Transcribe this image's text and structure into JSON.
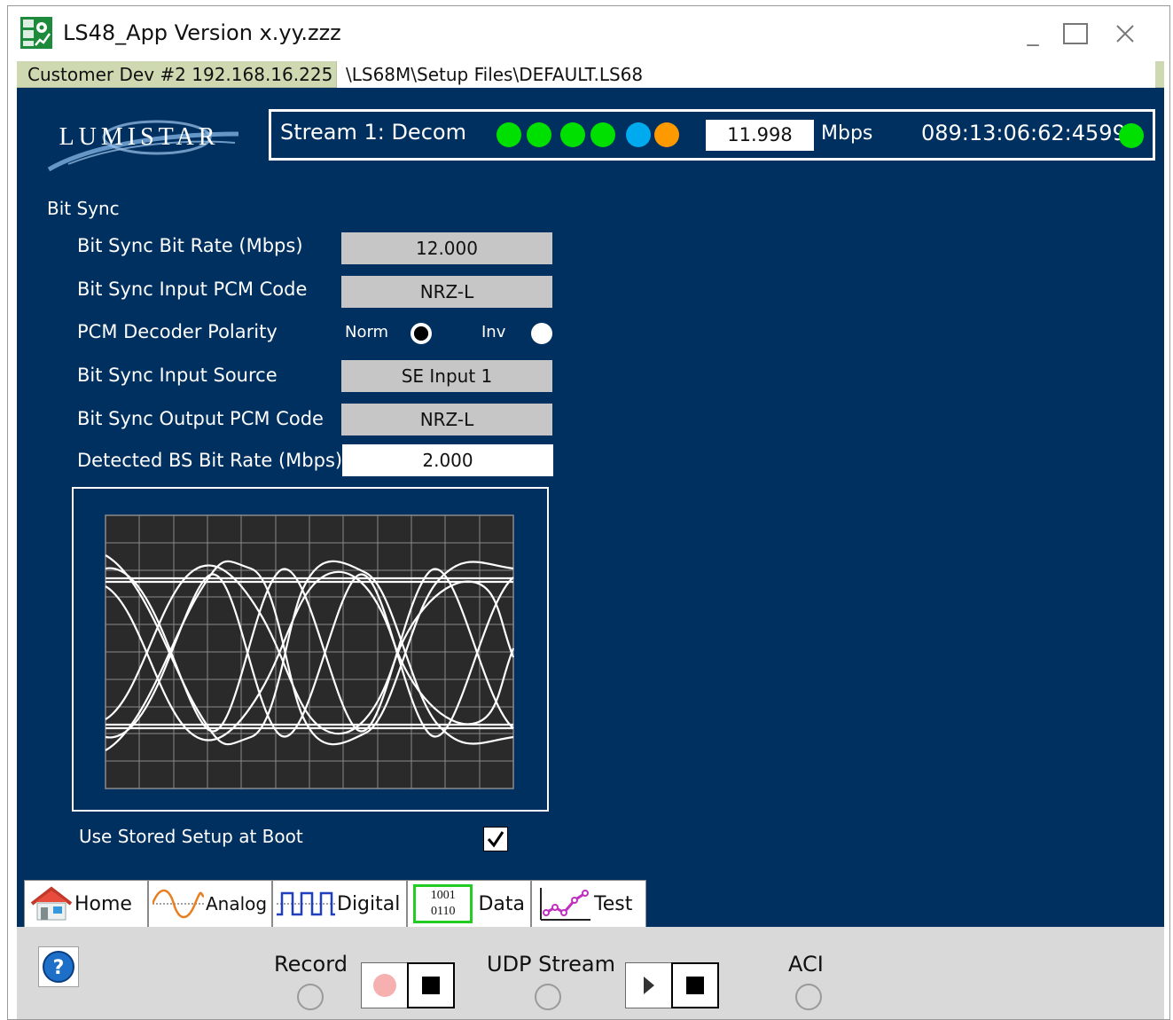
{
  "window": {
    "title": "LS48_App Version x.yy.zzz",
    "minimize_glyph": "_",
    "maximize_glyph": "☐",
    "close_glyph": "✕"
  },
  "pathbar": {
    "customer": "Customer Dev #2  192.168.16.225",
    "setup_path": "\\LS68M\\Setup Files\\DEFAULT.LS68"
  },
  "logo": {
    "text": "LUMISTAR"
  },
  "stream": {
    "label": "Stream 1:  Decom",
    "leds": [
      "#00e000",
      "#00e000",
      "#00e000",
      "#00e000",
      "#00aaee",
      "#ff9900"
    ],
    "rate": "11.998",
    "rate_unit": "Mbps",
    "time": "089:13:06:62:45992",
    "time_led": "#00e000"
  },
  "bitsync": {
    "section_title": "Bit Sync",
    "rows": [
      {
        "label": "Bit Sync Bit Rate (Mbps)",
        "value": "12.000"
      },
      {
        "label": "Bit Sync Input PCM Code",
        "value": "NRZ-L"
      },
      {
        "label": "PCM Decoder Polarity",
        "value": ""
      },
      {
        "label": "Bit Sync Input Source",
        "value": "SE Input 1"
      },
      {
        "label": "Bit Sync Output PCM Code",
        "value": "NRZ-L"
      },
      {
        "label": "Detected BS Bit Rate (Mbps)",
        "value": "2.000"
      }
    ],
    "polarity": {
      "norm_label": "Norm",
      "inv_label": "Inv",
      "selected": "Norm"
    }
  },
  "stored_setup": {
    "label": "Use Stored Setup at Boot",
    "checked": true
  },
  "tabs": [
    {
      "label": "Home",
      "icon": "house-icon"
    },
    {
      "label": "Analog",
      "icon": "sine-wave-icon"
    },
    {
      "label": "Digital",
      "icon": "square-wave-icon"
    },
    {
      "label": "Data",
      "icon": "binary-data-icon",
      "icon_text_top": "1001",
      "icon_text_bottom": "0110"
    },
    {
      "label": "Test",
      "icon": "line-chart-icon"
    }
  ],
  "bottom": {
    "help_glyph": "?",
    "record_label": "Record",
    "udp_label": "UDP Stream",
    "aci_label": "ACI"
  },
  "colors": {
    "panel": "#00305f",
    "pathbar": "#cfd9b1",
    "bottombar": "#d9d9d9"
  }
}
